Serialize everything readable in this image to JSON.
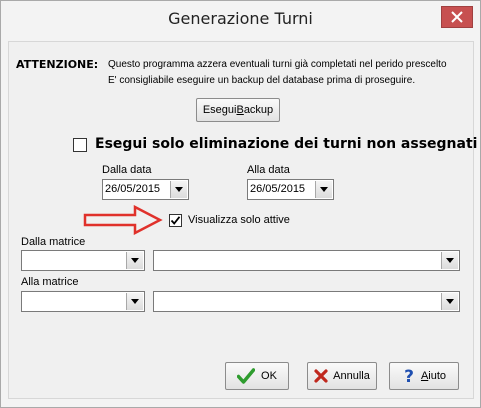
{
  "window": {
    "title": "Generazione Turni"
  },
  "warning": {
    "label": "ATTENZIONE:",
    "line1": "Questo programma azzera eventuali turni già completati nel perido prescelto",
    "line2": "E' consigliabile eseguire un backup del database prima di proseguire."
  },
  "backup_button": {
    "label_pre": "Esegui ",
    "label_accel": "B",
    "label_post": "ackup"
  },
  "only_delete": {
    "label": "Esegui solo eliminazione dei turni non assegnati",
    "checked": false
  },
  "from_date": {
    "label": "Dalla data",
    "value": "26/05/2015"
  },
  "to_date": {
    "label": "Alla data",
    "value": "26/05/2015"
  },
  "only_active": {
    "label": "Visualizza solo attive",
    "checked": true
  },
  "from_matrix": {
    "label": "Dalla matrice",
    "code": "",
    "description": ""
  },
  "to_matrix": {
    "label": "Alla matrice",
    "code": "",
    "description": ""
  },
  "buttons": {
    "ok": "OK",
    "cancel": "Annulla",
    "help_accel": "A",
    "help_rest": "iuto"
  },
  "colors": {
    "arrow": "#e0312b",
    "ok_check": "#2e9c2e",
    "cancel_x": "#c0281e",
    "help_q": "#1f4fb0",
    "close": "#c75050"
  }
}
